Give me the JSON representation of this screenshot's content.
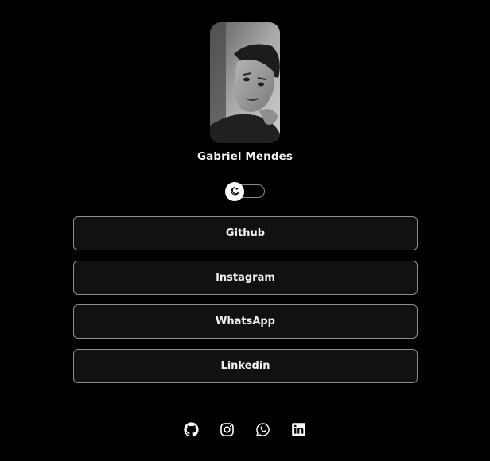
{
  "profile": {
    "name": "Gabriel Mendes"
  },
  "theme_toggle": {
    "icon": "moon-icon",
    "state": "dark"
  },
  "links": [
    {
      "label": "Github"
    },
    {
      "label": "Instagram"
    },
    {
      "label": "WhatsApp"
    },
    {
      "label": "Linkedin"
    }
  ],
  "socials": [
    {
      "icon": "github-icon"
    },
    {
      "icon": "instagram-icon"
    },
    {
      "icon": "whatsapp-icon"
    },
    {
      "icon": "linkedin-icon"
    }
  ],
  "colors": {
    "background": "#000000",
    "button_bg": "#111111",
    "button_border": "#8c8c8c",
    "text": "#f2f2f2"
  }
}
